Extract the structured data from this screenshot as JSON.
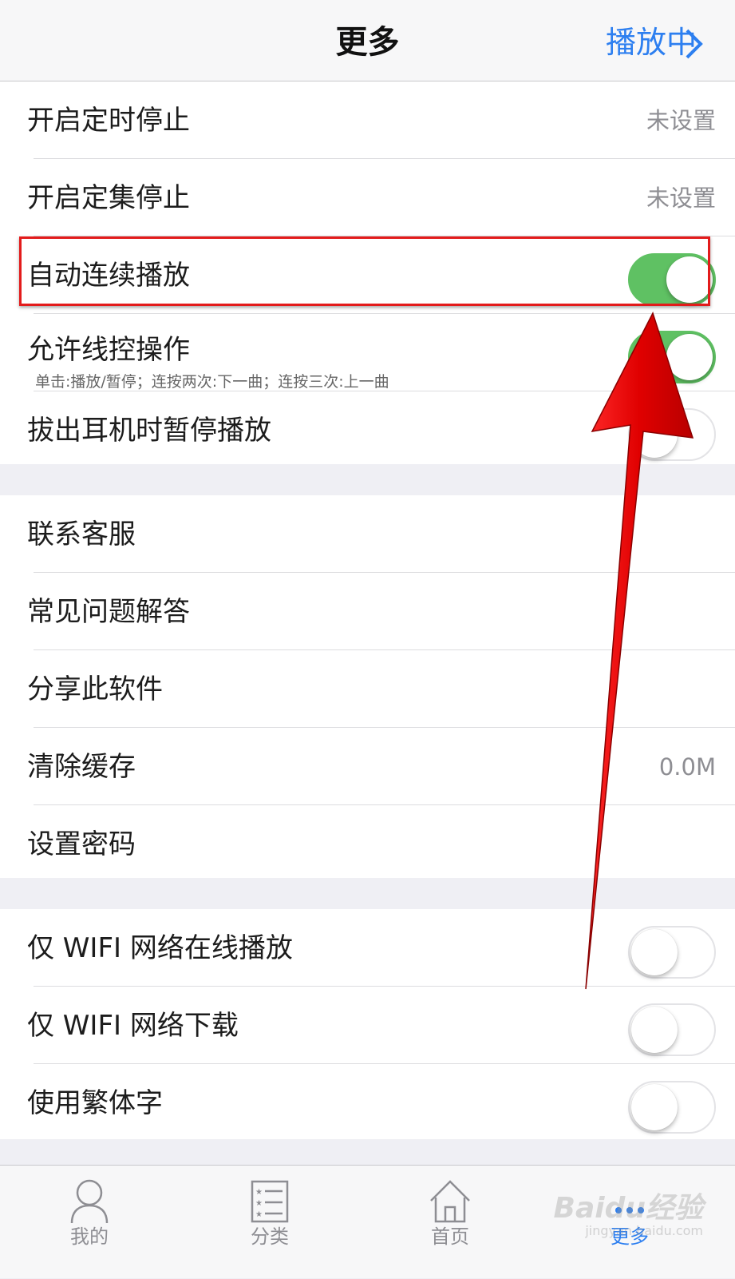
{
  "nav": {
    "title": "更多",
    "playing_label": "播放中"
  },
  "group1": {
    "rows": [
      {
        "label": "开启定时停止",
        "value": "未设置"
      },
      {
        "label": "开启定集停止",
        "value": "未设置"
      },
      {
        "label": "自动连续播放",
        "toggle": true
      },
      {
        "label": "允许线控操作",
        "sub": "单击:播放/暂停；连按两次:下一曲；连按三次:上一曲",
        "toggle": true
      },
      {
        "label": "拔出耳机时暂停播放",
        "toggle": false
      }
    ]
  },
  "group2": {
    "rows": [
      {
        "label": "联系客服"
      },
      {
        "label": "常见问题解答"
      },
      {
        "label": "分享此软件"
      },
      {
        "label": "清除缓存",
        "value": "0.0M"
      },
      {
        "label": "设置密码"
      }
    ]
  },
  "group3": {
    "rows": [
      {
        "label": "仅 WIFI 网络在线播放",
        "toggle": false
      },
      {
        "label": "仅 WIFI 网络下载",
        "toggle": false
      },
      {
        "label": "使用繁体字",
        "toggle": false
      }
    ]
  },
  "tabbar": {
    "tabs": [
      {
        "label": "我的",
        "icon": "person-icon"
      },
      {
        "label": "分类",
        "icon": "list-icon"
      },
      {
        "label": "首页",
        "icon": "home-icon"
      },
      {
        "label": "更多",
        "icon": "more-icon",
        "active": true
      }
    ]
  },
  "watermark": {
    "text": "Baidu经验",
    "url_text": "jingyan.baidu.com"
  },
  "colors": {
    "accent": "#2d7ff0",
    "toggle_on": "#5fc163",
    "annotation": "#e31b1b"
  }
}
